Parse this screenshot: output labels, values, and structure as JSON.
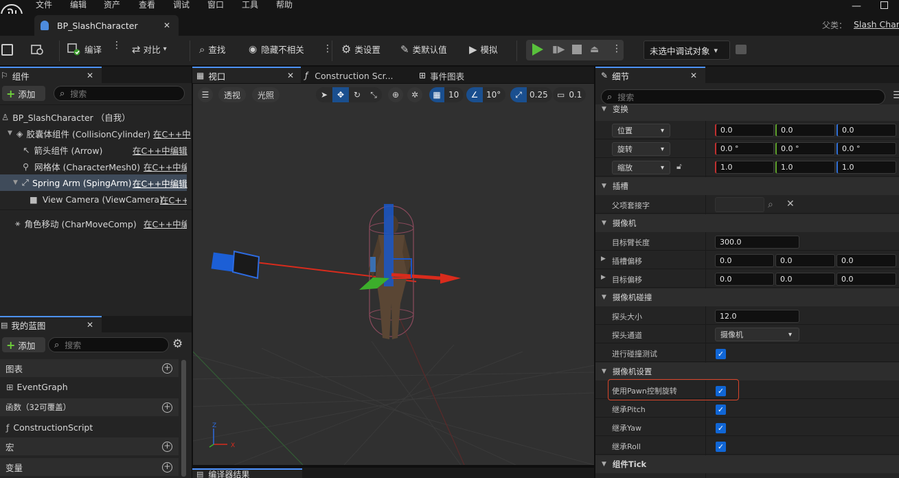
{
  "menu": [
    "文件",
    "编辑",
    "资产",
    "查看",
    "调试",
    "窗口",
    "工具",
    "帮助"
  ],
  "document_tab": {
    "title": "BP_SlashCharacter"
  },
  "parent": {
    "label": "父类：",
    "value": "Slash Character"
  },
  "toolbar": {
    "compile": "编译",
    "diff": "对比",
    "find": "查找",
    "hide_unrelated": "隐藏不相关",
    "class_settings": "类设置",
    "class_defaults": "类默认值",
    "simulate": "模拟",
    "debug_select": "未选中调试对象"
  },
  "components_panel": {
    "tab": "组件",
    "add": "添加",
    "search_placeholder": "搜索",
    "items": [
      {
        "name": "BP_SlashCharacter （自我）",
        "link": ""
      },
      {
        "name": "胶囊体组件 (CollisionCylinder)",
        "link": "在C++中"
      },
      {
        "name": "箭头组件 (Arrow)",
        "link": "在C++中编辑"
      },
      {
        "name": "网格体 (CharacterMesh0)",
        "link": "在C++中编辑"
      },
      {
        "name": "Spring Arm (SpingArm)",
        "link": "在C++中编辑"
      },
      {
        "name": "View Camera (ViewCamera)",
        "link": "在C++中"
      },
      {
        "name": "角色移动 (CharMoveComp)",
        "link": "在C++中编辑"
      }
    ]
  },
  "my_blueprint": {
    "tab": "我的蓝图",
    "add": "添加",
    "search_placeholder": "搜索",
    "sections": {
      "graphs": "图表",
      "event_graph": "EventGraph",
      "functions": "函数（32可覆盖）",
      "construction_script": "ConstructionScript",
      "macros": "宏",
      "variables": "变量"
    }
  },
  "center_tabs": {
    "viewport": "视口",
    "construction": "Construction Scr...",
    "event_graph": "事件图表",
    "compiler_results": "编译器结果"
  },
  "viewport": {
    "perspective": "透视",
    "lit": "光照",
    "grid_snap": "10",
    "rot_snap": "10°",
    "scale_snap": "0.25",
    "camera_speed": "0.1"
  },
  "details": {
    "tab": "细节",
    "search_placeholder": "搜索",
    "transform": {
      "header": "变换",
      "location": {
        "label": "位置",
        "x": "0.0",
        "y": "0.0",
        "z": "0.0"
      },
      "rotation": {
        "label": "旋转",
        "x": "0.0 °",
        "y": "0.0 °",
        "z": "0.0 °"
      },
      "scale": {
        "label": "缩放",
        "x": "1.0",
        "y": "1.0",
        "z": "1.0"
      }
    },
    "sockets": {
      "header": "插槽",
      "parent_socket": "父项套接字"
    },
    "camera": {
      "header": "摄像机",
      "arm_length_label": "目标臂长度",
      "arm_length": "300.0",
      "socket_offset_label": "插槽偏移",
      "socket_offset": [
        "0.0",
        "0.0",
        "0.0"
      ],
      "target_offset_label": "目标偏移",
      "target_offset": [
        "0.0",
        "0.0",
        "0.0"
      ]
    },
    "camera_collision": {
      "header": "摄像机碰撞",
      "probe_size_label": "探头大小",
      "probe_size": "12.0",
      "probe_channel_label": "探头通道",
      "probe_channel": "摄像机",
      "do_collision_test": "进行碰撞测试"
    },
    "camera_settings": {
      "header": "摄像机设置",
      "use_pawn_control_rotation": "使用Pawn控制旋转",
      "inherit_pitch": "继承Pitch",
      "inherit_yaw": "继承Yaw",
      "inherit_roll": "继承Roll"
    },
    "component_tick": {
      "header": "组件Tick"
    }
  },
  "colors": {
    "accent": "#1066d6",
    "highlight_box": "#d9452a",
    "play": "#59c13c"
  }
}
